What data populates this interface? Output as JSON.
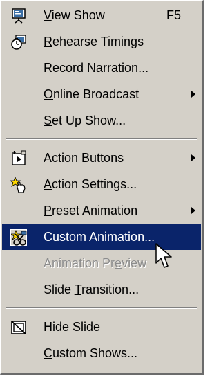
{
  "menu": {
    "items": [
      {
        "type": "item",
        "label_pre": "",
        "mnemonic": "V",
        "label_post": "iew Show",
        "shortcut": "F5",
        "icon": "view-show-icon",
        "submenu": false,
        "state": "normal"
      },
      {
        "type": "item",
        "label_pre": "",
        "mnemonic": "R",
        "label_post": "ehearse Timings",
        "shortcut": "",
        "icon": "rehearse-timings-icon",
        "submenu": false,
        "state": "normal"
      },
      {
        "type": "item",
        "label_pre": "Record ",
        "mnemonic": "N",
        "label_post": "arration...",
        "shortcut": "",
        "icon": "",
        "submenu": false,
        "state": "normal"
      },
      {
        "type": "item",
        "label_pre": "",
        "mnemonic": "O",
        "label_post": "nline Broadcast",
        "shortcut": "",
        "icon": "",
        "submenu": true,
        "state": "normal"
      },
      {
        "type": "item",
        "label_pre": "",
        "mnemonic": "S",
        "label_post": "et Up Show...",
        "shortcut": "",
        "icon": "",
        "submenu": false,
        "state": "normal"
      },
      {
        "type": "separator"
      },
      {
        "type": "item",
        "label_pre": "Act",
        "mnemonic": "i",
        "label_post": "on Buttons",
        "shortcut": "",
        "icon": "action-buttons-icon",
        "submenu": true,
        "state": "normal"
      },
      {
        "type": "item",
        "label_pre": "",
        "mnemonic": "A",
        "label_post": "ction Settings...",
        "shortcut": "",
        "icon": "action-settings-icon",
        "submenu": false,
        "state": "normal"
      },
      {
        "type": "item",
        "label_pre": "",
        "mnemonic": "P",
        "label_post": "reset Animation",
        "shortcut": "",
        "icon": "",
        "submenu": true,
        "state": "normal"
      },
      {
        "type": "item",
        "label_pre": "Custo",
        "mnemonic": "m",
        "label_post": " Animation...",
        "shortcut": "",
        "icon": "custom-animation-icon",
        "submenu": false,
        "state": "selected"
      },
      {
        "type": "item",
        "label_pre": "Animation Pr",
        "mnemonic": "e",
        "label_post": "view",
        "shortcut": "",
        "icon": "",
        "submenu": false,
        "state": "disabled"
      },
      {
        "type": "item",
        "label_pre": "Slide ",
        "mnemonic": "T",
        "label_post": "ransition...",
        "shortcut": "",
        "icon": "",
        "submenu": false,
        "state": "normal"
      },
      {
        "type": "separator"
      },
      {
        "type": "item",
        "label_pre": "",
        "mnemonic": "H",
        "label_post": "ide Slide",
        "shortcut": "",
        "icon": "hide-slide-icon",
        "submenu": false,
        "state": "normal"
      },
      {
        "type": "item",
        "label_pre": "",
        "mnemonic": "C",
        "label_post": "ustom Shows...",
        "shortcut": "",
        "icon": "",
        "submenu": false,
        "state": "normal"
      }
    ]
  },
  "colors": {
    "menu_bg": "#d4d0c8",
    "highlight": "#0a246a",
    "disabled_text": "#8c8c8c"
  },
  "cursor": {
    "icon": "arrow-cursor-icon"
  }
}
